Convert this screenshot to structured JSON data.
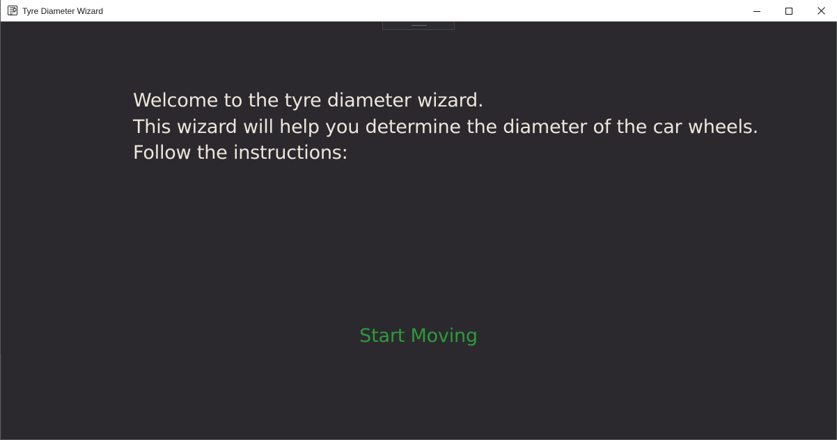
{
  "window": {
    "title": "Tyre Diameter Wizard",
    "controls": {
      "minimize": "minimize-icon",
      "maximize": "maximize-icon",
      "close": "close-icon"
    }
  },
  "wizard": {
    "intro_lines": [
      "Welcome to the tyre diameter wizard.",
      "This wizard will help you determine the diameter of the car wheels.",
      "Follow the instructions:"
    ],
    "action_label": "Start Moving"
  },
  "colors": {
    "background": "#2b292e",
    "text": "#ece6dc",
    "action": "#2e9a3c"
  }
}
